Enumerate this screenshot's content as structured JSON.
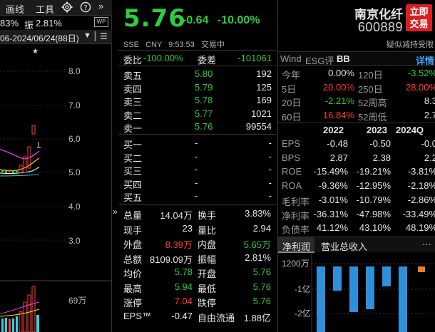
{
  "left": {
    "toolbar": {
      "draw": "画线",
      "tools": "工具",
      "gear_icon": "gear-icon",
      "help_icon": "help-icon",
      "more_icon": "double-chevron-right-icon"
    },
    "info": {
      "partial": "83%",
      "amp_label": "振",
      "amp_value": "2.81%"
    },
    "date_range": "06-2024/06/24(88日)",
    "price_axis": [
      "8.0",
      "7.0",
      "6.0",
      "5.0",
      "4.0",
      "3.0"
    ],
    "vol_axis": "69万"
  },
  "price": {
    "last": "5.76",
    "change": "-0.64",
    "change_pct": "-10.00%",
    "exchange": "SSE",
    "currency": "CNY",
    "time": "9:53:53",
    "status": "交易中"
  },
  "book": {
    "weibi_label": "委比",
    "weibi_value": "-100.00%",
    "weicha_label": "委差",
    "weicha_value": "-101061",
    "asks": [
      {
        "label": "卖五",
        "price": "5.80",
        "vol": "192"
      },
      {
        "label": "卖四",
        "price": "5.79",
        "vol": "125"
      },
      {
        "label": "卖三",
        "price": "5.78",
        "vol": "169"
      },
      {
        "label": "卖二",
        "price": "5.77",
        "vol": "1021"
      },
      {
        "label": "卖一",
        "price": "5.76",
        "vol": "99554"
      }
    ],
    "bids": [
      {
        "label": "买一",
        "price": "-",
        "vol": "-"
      },
      {
        "label": "买二",
        "price": "-",
        "vol": "-"
      },
      {
        "label": "买三",
        "price": "-",
        "vol": "-"
      },
      {
        "label": "买四",
        "price": "-",
        "vol": "-"
      },
      {
        "label": "买五",
        "price": "-",
        "vol": "-"
      }
    ]
  },
  "stats": [
    {
      "l1": "总量",
      "v1": "14.04万",
      "l2": "换手",
      "v2": "3.83%",
      "c1": "white",
      "c2": "white"
    },
    {
      "l1": "现手",
      "v1": "23",
      "l2": "量比",
      "v2": "2.94",
      "c1": "white",
      "c2": "white"
    },
    {
      "l1": "外盘",
      "v1": "8.39万",
      "l2": "内盘",
      "v2": "5.65万",
      "c1": "red",
      "c2": "green"
    },
    {
      "l1": "总额",
      "v1": "8109.09万",
      "l2": "振幅",
      "v2": "2.81%",
      "c1": "white",
      "c2": "white"
    },
    {
      "l1": "均价",
      "v1": "5.78",
      "l2": "开盘",
      "v2": "5.76",
      "c1": "green",
      "c2": "green"
    },
    {
      "l1": "最高",
      "v1": "5.94",
      "l2": "最低",
      "v2": "5.76",
      "c1": "green",
      "c2": "green"
    },
    {
      "l1": "涨停",
      "v1": "7.04",
      "l2": "跌停",
      "v2": "5.76",
      "c1": "red",
      "c2": "green"
    },
    {
      "l1": "EPS™",
      "v1": "-0.47",
      "l2": "自由流通",
      "v2": "1.88亿",
      "c1": "white",
      "c2": "white"
    }
  ],
  "right": {
    "name": "南京化纤",
    "code": "600889",
    "trade_btn_line1": "立即",
    "trade_btn_line2": "交易",
    "risk_tag": "疑似减持受限",
    "wind_label": "Wind",
    "esg_label": "ESG评",
    "esg_grade": "BB",
    "detail_label": "详情",
    "returns": [
      {
        "l1": "今年",
        "v1": "0.00%",
        "c1": "white",
        "l2": "120日",
        "v2": "-3.52%",
        "c2": "green"
      },
      {
        "l1": "5日",
        "v1": "20.00%",
        "c1": "red",
        "l2": "250日",
        "v2": "28.00%",
        "c2": "red"
      },
      {
        "l1": "20日",
        "v1": "-2.21%",
        "c1": "green",
        "l2": "52周高",
        "v2": "8.3",
        "c2": "white"
      },
      {
        "l1": "60日",
        "v1": "16.84%",
        "c1": "red",
        "l2": "52周低",
        "v2": "2.7",
        "c2": "white"
      }
    ],
    "years": [
      "2022",
      "2023",
      "2024Q"
    ],
    "fin": [
      {
        "label": "EPS",
        "v": [
          "-0.48",
          "-0.50",
          "-0.0"
        ]
      },
      {
        "label": "BPS",
        "v": [
          "2.87",
          "2.38",
          "2.2"
        ]
      },
      {
        "label": "ROE",
        "v": [
          "-15.49%",
          "-19.21%",
          "-3.81%"
        ]
      },
      {
        "label": "ROA",
        "v": [
          "-9.36%",
          "-12.95%",
          "-2.18%"
        ]
      },
      {
        "label": "毛利率",
        "v": [
          "-3.01%",
          "-10.79%",
          "-2.86%"
        ]
      },
      {
        "label": "净利率",
        "v": [
          "-36.31%",
          "-47.98%",
          "-33.49%"
        ]
      },
      {
        "label": "负债率",
        "v": [
          "41.12%",
          "43.10%",
          "48.19%"
        ]
      }
    ],
    "tab_net_profit": "净利润",
    "tab_revenue": "营业总收入",
    "bar_axis": [
      "1200万",
      "-1亿",
      "-2亿"
    ]
  },
  "colors": {
    "up": "#ff3b3b",
    "down": "#2ecc40",
    "bar": "#2f8fd8",
    "bar_pos": "#e0821f"
  }
}
